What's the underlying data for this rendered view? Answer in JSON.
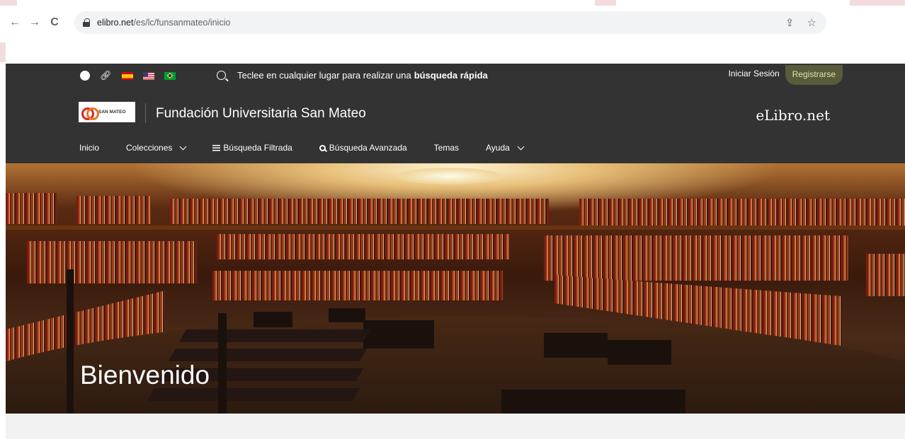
{
  "browser": {
    "url_host": "elibro.net",
    "url_path": "/es/lc/funsanmateo/inicio",
    "back_icon": "←",
    "forward_icon": "→",
    "reload_icon": "C",
    "share_icon": "⇪",
    "star_icon": "☆"
  },
  "topbar": {
    "quick_search_text": "Teclee en cualquier lugar para realizar una",
    "quick_search_bold": "búsqueda rápida",
    "login_label": "Iniciar Sesión",
    "register_label": "Registrarse"
  },
  "brand": {
    "logo_text_line1": "SAN MATEO",
    "org_name": "Fundación Universitaria San Mateo",
    "elibro_label": "eLibro.net"
  },
  "menu": {
    "home": "Inicio",
    "collections": "Colecciones",
    "filtered_search": "Búsqueda Filtrada",
    "advanced_search": "Búsqueda Avanzada",
    "topics": "Temas",
    "help": "Ayuda"
  },
  "hero": {
    "title": "Bienvenido"
  },
  "colors": {
    "header_bg": "#333333",
    "register_highlight": "#5a5b3a",
    "accent_red": "#d8232a"
  }
}
